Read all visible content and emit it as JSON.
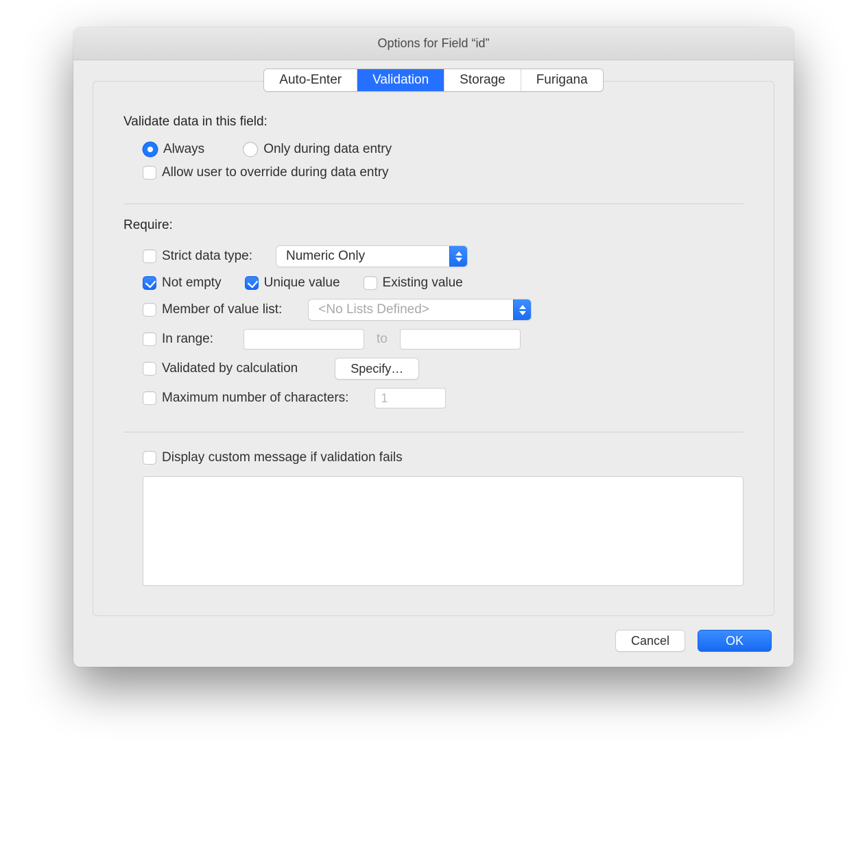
{
  "window": {
    "title": "Options for Field “id”"
  },
  "tabs": {
    "auto_enter": "Auto-Enter",
    "validation": "Validation",
    "storage": "Storage",
    "furigana": "Furigana"
  },
  "validate": {
    "heading": "Validate data in this field:",
    "always": "Always",
    "only_during": "Only during data entry",
    "allow_override": "Allow user to override during data entry"
  },
  "require": {
    "heading": "Require:",
    "strict_type": "Strict data type:",
    "strict_type_value": "Numeric Only",
    "not_empty": "Not empty",
    "unique": "Unique value",
    "existing": "Existing value",
    "member": "Member of value list:",
    "member_value": "<No Lists Defined>",
    "in_range": "In range:",
    "range_to": "to",
    "calc": "Validated by calculation",
    "specify": "Specify…",
    "max_chars": "Maximum number of characters:",
    "max_chars_value": "1"
  },
  "message": {
    "label": "Display custom message if validation fails",
    "text": ""
  },
  "footer": {
    "cancel": "Cancel",
    "ok": "OK"
  }
}
